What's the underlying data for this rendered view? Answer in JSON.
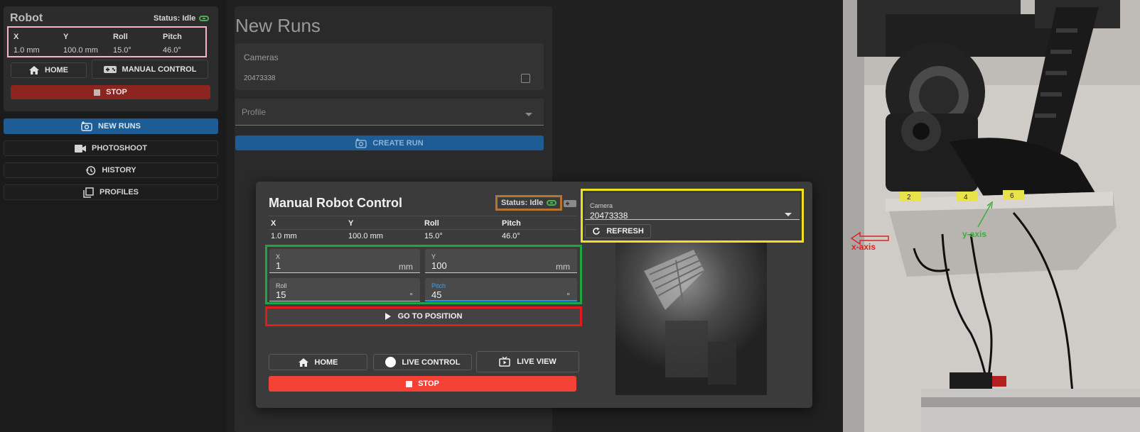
{
  "sidebar": {
    "robot_card": {
      "title": "Robot",
      "status": "Status: Idle",
      "headers": [
        "X",
        "Y",
        "Roll",
        "Pitch"
      ],
      "values": [
        "1.0 mm",
        "100.0 mm",
        "15.0°",
        "46.0°"
      ],
      "home_label": "HOME",
      "manual_label": "MANUAL CONTROL",
      "stop_label": "STOP"
    },
    "nav": [
      {
        "label": "NEW RUNS",
        "icon": "camera-add-icon",
        "active": true
      },
      {
        "label": "PHOTOSHOOT",
        "icon": "video-camera-icon",
        "active": false
      },
      {
        "label": "HISTORY",
        "icon": "history-icon",
        "active": false
      },
      {
        "label": "PROFILES",
        "icon": "profiles-icon",
        "active": false
      }
    ]
  },
  "main": {
    "title": "New Runs",
    "cameras_label": "Cameras",
    "camera_id": "20473338",
    "profile_placeholder": "Profile",
    "create_run_label": "CREATE RUN"
  },
  "dialog": {
    "title": "Manual Robot Control",
    "status": "Status: Idle",
    "headers": [
      "X",
      "Y",
      "Roll",
      "Pitch"
    ],
    "values": [
      "1.0 mm",
      "100.0 mm",
      "15.0°",
      "46.0°"
    ],
    "fields": {
      "x": {
        "label": "X",
        "value": "1",
        "suffix": "mm"
      },
      "y": {
        "label": "Y",
        "value": "100",
        "suffix": "mm"
      },
      "roll": {
        "label": "Roll",
        "value": "15",
        "suffix": "°"
      },
      "pitch": {
        "label": "Pitch",
        "value": "45",
        "suffix": "°"
      }
    },
    "go_label": "GO TO POSITION",
    "home_label": "HOME",
    "live_control_label": "LIVE CONTROL",
    "live_view_label": "LIVE VIEW",
    "stop_label": "STOP",
    "camera_label": "Camera",
    "camera_value": "20473338",
    "refresh_label": "REFRESH"
  },
  "photo": {
    "x_axis_label": "x-axis",
    "y_axis_label": "y-axis",
    "labels": [
      "2",
      "4",
      "6"
    ]
  },
  "colors": {
    "accent_blue": "#1d5c94",
    "stop_red": "#f44336",
    "status_green": "#4caf50"
  }
}
